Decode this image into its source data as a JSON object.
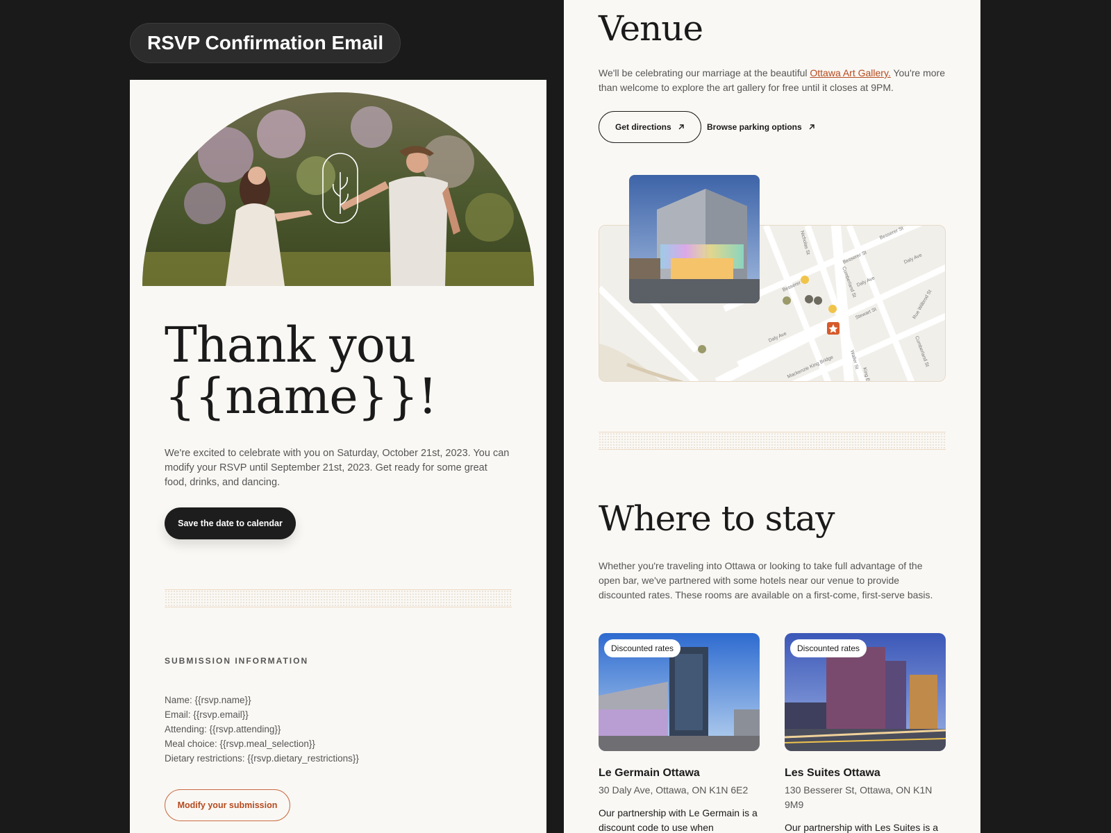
{
  "header": {
    "title": "RSVP Confirmation Email"
  },
  "left": {
    "heading_line1": "Thank you",
    "heading_line2": "{{name}}!",
    "intro": "We're excited to celebrate with you on Saturday, October 21st, 2023. You can modify your RSVP until September 21st, 2023. Get ready for some great food, drinks, and dancing.",
    "save_button": "Save the date to calendar",
    "submission_heading": "SUBMISSION INFORMATION",
    "submission_lines": [
      "Name: {{rsvp.name}}",
      "Email: {{rsvp.email}}",
      "Attending: {{rsvp.attending}}",
      "Meal choice: {{rsvp.meal_selection}}",
      "Dietary restrictions: {{rsvp.dietary_restrictions}}"
    ],
    "modify_button": "Modify your submission"
  },
  "venue": {
    "title": "Venue",
    "text_before": "We'll be celebrating our marriage at the beautiful ",
    "link": "Ottawa Art Gallery.",
    "text_after": " You're more than welcome to explore the art gallery for free until it closes at 9PM.",
    "directions_button": "Get directions",
    "parking_button": "Browse parking options",
    "map_streets": [
      "Besserer St",
      "Besserer St",
      "Besserer St",
      "Daly Ave",
      "Daly Ave",
      "Daly Ave",
      "Stewart St",
      "Rue Wilbrod St",
      "Cumberland St",
      "Cumberland St",
      "Mackenzie King Bridge",
      "Nicholas St",
      "Waller St",
      "King Edward Ave"
    ]
  },
  "stay": {
    "title": "Where to stay",
    "intro": "Whether you're traveling into Ottawa or looking to take full advantage of the open bar, we've partnered with some hotels near our venue to provide discounted rates. These rooms are available on a first-come, first-serve basis.",
    "hotels": [
      {
        "badge": "Discounted rates",
        "name": "Le Germain Ottawa",
        "address": "30 Daly Ave, Ottawa, ON K1N 6E2",
        "description": "Our partnership with Le Germain is a discount code to use when"
      },
      {
        "badge": "Discounted rates",
        "name": "Les Suites Ottawa",
        "address": "130 Besserer St, Ottawa, ON K1N 9M9",
        "description": "Our partnership with Les Suites is a"
      }
    ]
  },
  "colors": {
    "background": "#1a1a1a",
    "panel": "#faf8f4",
    "accent": "#b54a1f",
    "dark_button": "#1d1d1d"
  },
  "icons": [
    "leaf-emblem-icon",
    "arrow-up-right-icon",
    "map-pin-icon",
    "venue-star-marker-icon",
    "parking-pin-icon"
  ]
}
